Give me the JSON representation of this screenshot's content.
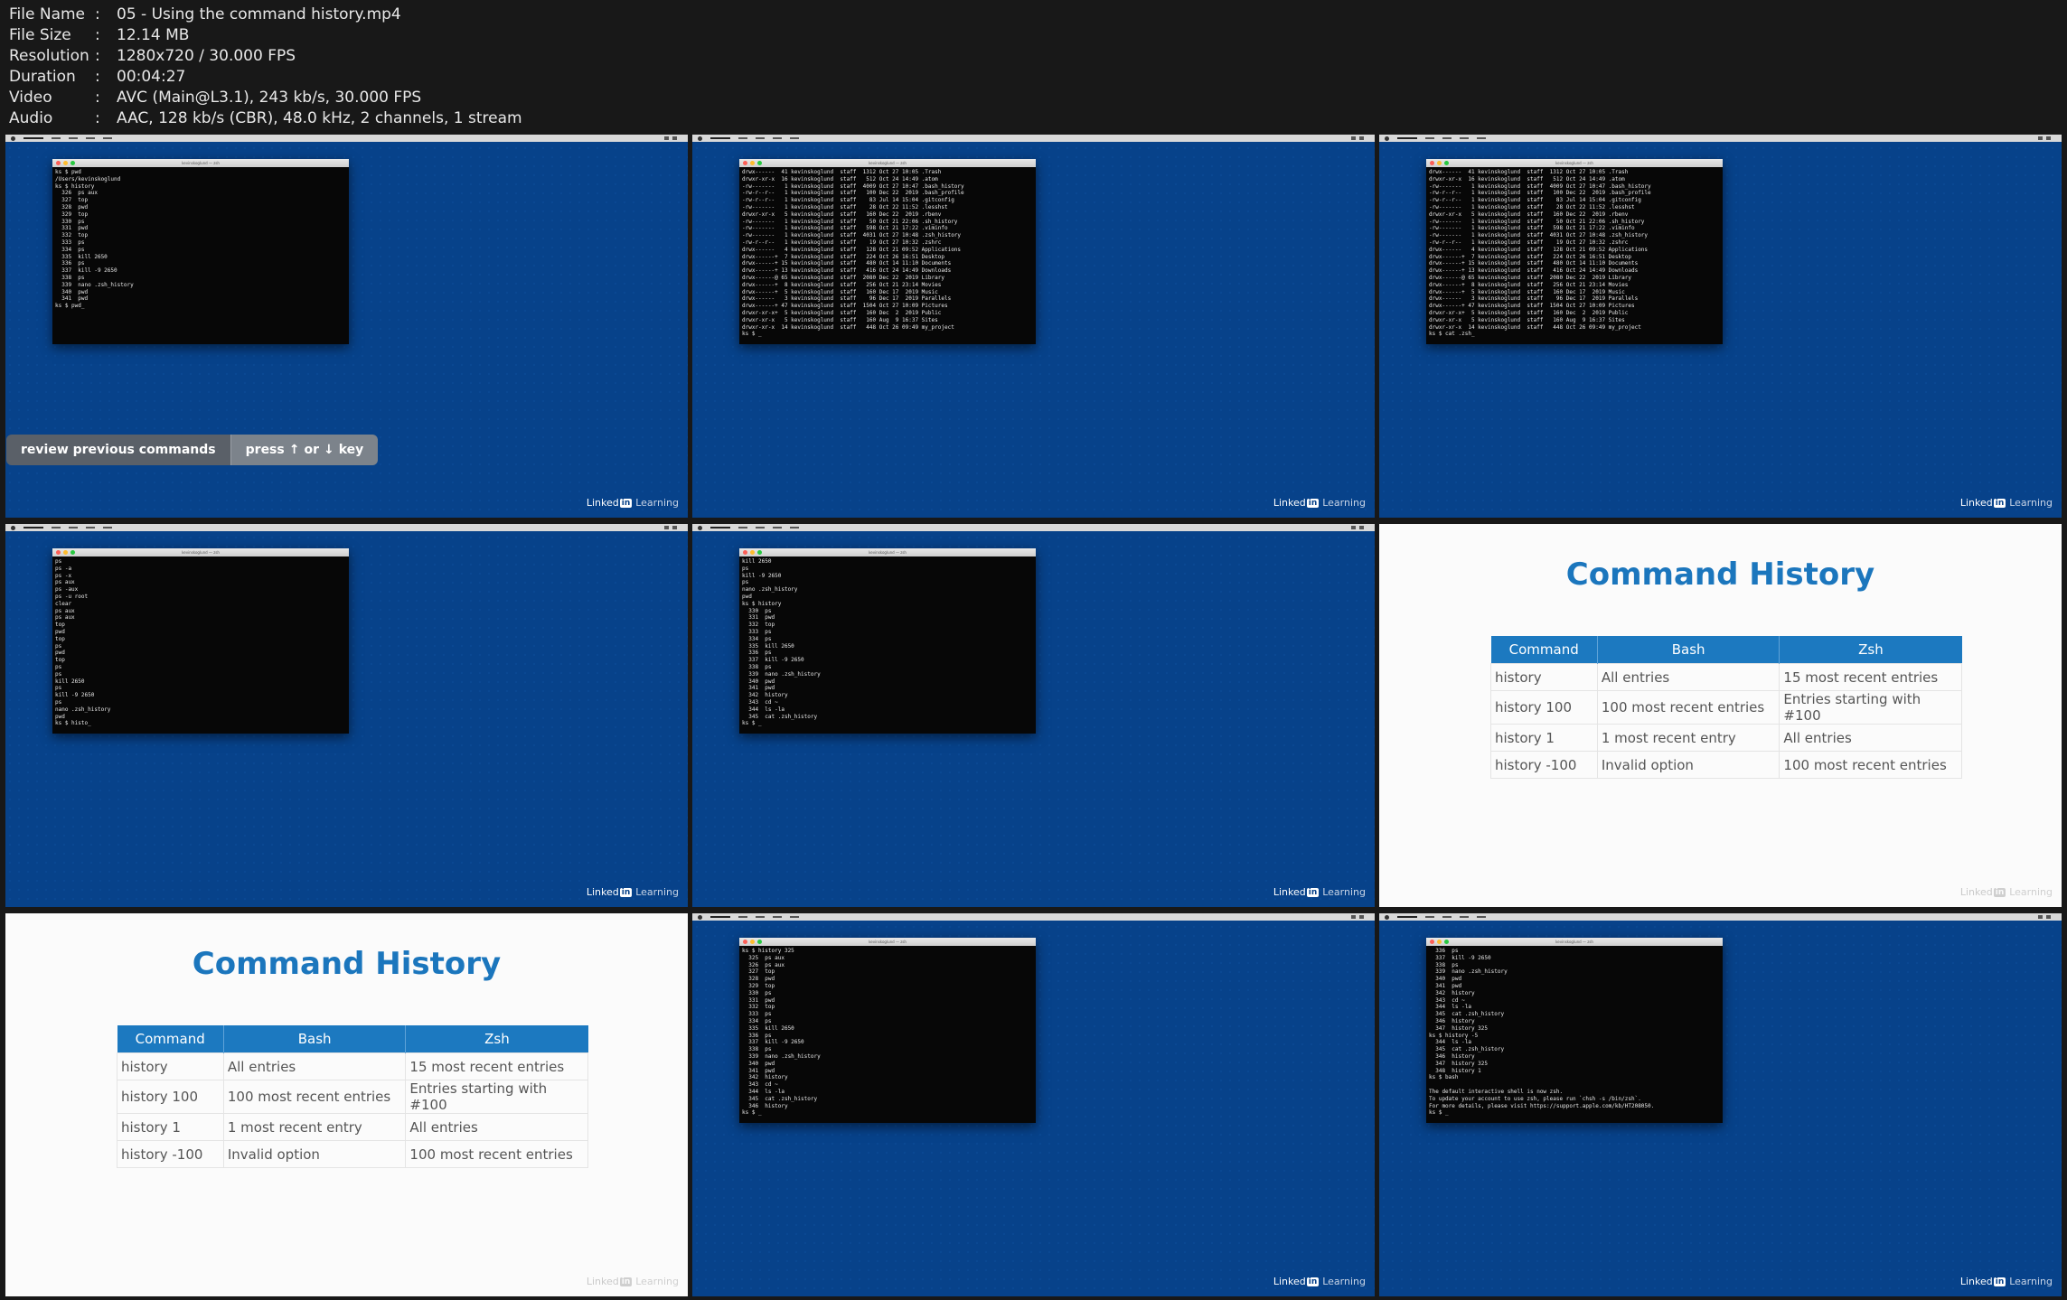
{
  "info": [
    {
      "key": "File Name",
      "value": "05 - Using the command history.mp4"
    },
    {
      "key": "File Size",
      "value": "12.14 MB"
    },
    {
      "key": "Resolution",
      "value": "1280x720 / 30.000 FPS"
    },
    {
      "key": "Duration",
      "value": "00:04:27"
    },
    {
      "key": "Video",
      "value": "AVC (Main@L3.1), 243 kb/s, 30.000 FPS"
    },
    {
      "key": "Audio",
      "value": "AAC, 128 kb/s (CBR), 48.0 kHz, 2 channels, 1 stream"
    }
  ],
  "colon": ":",
  "terminal_title": "kevinskoglund — zsh",
  "brand": {
    "linked": "Linked",
    "in": "in",
    "learning": "Learning"
  },
  "caption": {
    "left": "review previous commands",
    "press": "press",
    "up": "↑",
    "or": "or",
    "down": "↓",
    "key": "key"
  },
  "slide": {
    "title": "Command History",
    "headers": [
      "Command",
      "Bash",
      "Zsh"
    ],
    "rows": [
      [
        "history",
        "All entries",
        "15 most recent entries"
      ],
      [
        "history 100",
        "100 most recent entries",
        "Entries starting with #100"
      ],
      [
        "history 1",
        "1 most recent entry",
        "All entries"
      ],
      [
        "history -100",
        "Invalid option",
        "100 most recent entries"
      ]
    ]
  },
  "terminals": {
    "t1": "ks $ pwd\n/Users/kevinskoglund\nks $ history\n  326  ps aux\n  327  top\n  328  pwd\n  329  top\n  330  ps\n  331  pwd\n  332  top\n  333  ps\n  334  ps\n  335  kill 2650\n  336  ps\n  337  kill -9 2650\n  338  ps\n  339  nano .zsh_history\n  340  pwd\n  341  pwd\nks $ pwd_",
    "t2": "drwx------  41 kevinskoglund  staff  1312 Oct 27 10:05 .Trash\ndrwxr-xr-x  16 kevinskoglund  staff   512 Oct 24 14:49 .atom\n-rw-------   1 kevinskoglund  staff  4009 Oct 27 10:47 .bash_history\n-rw-r--r--   1 kevinskoglund  staff   100 Dec 22  2019 .bash_profile\n-rw-r--r--   1 kevinskoglund  staff    83 Jul 14 15:04 .gitconfig\n-rw-------   1 kevinskoglund  staff    28 Oct 22 11:52 .lesshst\ndrwxr-xr-x   5 kevinskoglund  staff   160 Dec 22  2019 .rbenv\n-rw-------   1 kevinskoglund  staff    50 Oct 21 22:06 .sh_history\n-rw-------   1 kevinskoglund  staff   598 Oct 21 17:22 .viminfo\n-rw-------   1 kevinskoglund  staff  4031 Oct 27 10:48 .zsh_history\n-rw-r--r--   1 kevinskoglund  staff    19 Oct 27 10:32 .zshrc\ndrwx------   4 kevinskoglund  staff   128 Oct 21 09:52 Applications\ndrwx------+  7 kevinskoglund  staff   224 Oct 26 16:51 Desktop\ndrwx------+ 15 kevinskoglund  staff   480 Oct 14 11:10 Documents\ndrwx------+ 13 kevinskoglund  staff   416 Oct 24 14:49 Downloads\ndrwx------@ 65 kevinskoglund  staff  2080 Dec 22  2019 Library\ndrwx------+  8 kevinskoglund  staff   256 Oct 21 23:14 Movies\ndrwx------+  5 kevinskoglund  staff   160 Dec 17  2019 Music\ndrwx------   3 kevinskoglund  staff    96 Dec 17  2019 Parallels\ndrwx------+ 47 kevinskoglund  staff  1504 Oct 27 10:09 Pictures\ndrwxr-xr-x+  5 kevinskoglund  staff   160 Dec  2  2019 Public\ndrwxr-xr-x   5 kevinskoglund  staff   160 Aug  9 16:37 Sites\ndrwxr-xr-x  14 kevinskoglund  staff   448 Oct 26 09:49 my_project\nks $ _",
    "t3": "drwx------  41 kevinskoglund  staff  1312 Oct 27 10:05 .Trash\ndrwxr-xr-x  16 kevinskoglund  staff   512 Oct 24 14:49 .atom\n-rw-------   1 kevinskoglund  staff  4009 Oct 27 10:47 .bash_history\n-rw-r--r--   1 kevinskoglund  staff   100 Dec 22  2019 .bash_profile\n-rw-r--r--   1 kevinskoglund  staff    83 Jul 14 15:04 .gitconfig\n-rw-------   1 kevinskoglund  staff    28 Oct 22 11:52 .lesshst\ndrwxr-xr-x   5 kevinskoglund  staff   160 Dec 22  2019 .rbenv\n-rw-------   1 kevinskoglund  staff    50 Oct 21 22:06 .sh_history\n-rw-------   1 kevinskoglund  staff   598 Oct 21 17:22 .viminfo\n-rw-------   1 kevinskoglund  staff  4031 Oct 27 10:48 .zsh_history\n-rw-r--r--   1 kevinskoglund  staff    19 Oct 27 10:32 .zshrc\ndrwx------   4 kevinskoglund  staff   128 Oct 21 09:52 Applications\ndrwx------+  7 kevinskoglund  staff   224 Oct 26 16:51 Desktop\ndrwx------+ 15 kevinskoglund  staff   480 Oct 14 11:10 Documents\ndrwx------+ 13 kevinskoglund  staff   416 Oct 24 14:49 Downloads\ndrwx------@ 65 kevinskoglund  staff  2080 Dec 22  2019 Library\ndrwx------+  8 kevinskoglund  staff   256 Oct 21 23:14 Movies\ndrwx------+  5 kevinskoglund  staff   160 Dec 17  2019 Music\ndrwx------   3 kevinskoglund  staff    96 Dec 17  2019 Parallels\ndrwx------+ 47 kevinskoglund  staff  1504 Oct 27 10:09 Pictures\ndrwxr-xr-x+  5 kevinskoglund  staff   160 Dec  2  2019 Public\ndrwxr-xr-x   5 kevinskoglund  staff   160 Aug  9 16:37 Sites\ndrwxr-xr-x  14 kevinskoglund  staff   448 Oct 26 09:49 my_project\nks $ cat .zsh_",
    "t4": "ps\nps -a\nps -x\nps aux\nps -aux\nps -u root\nclear\nps aux\nps aux\ntop\npwd\ntop\nps\npwd\ntop\nps\nps\nkill 2650\nps\nkill -9 2650\nps\nnano .zsh_history\npwd\nks $ histo_",
    "t5": "kill 2650\nps\nkill -9 2650\nps\nnano .zsh_history\npwd\nks $ history\n  330  ps\n  331  pwd\n  332  top\n  333  ps\n  334  ps\n  335  kill 2650\n  336  ps\n  337  kill -9 2650\n  338  ps\n  339  nano .zsh_history\n  340  pwd\n  341  pwd\n  342  history\n  343  cd ~\n  344  ls -la\n  345  cat .zsh_history\nks $ _",
    "t8": "ks $ history 325\n  325  ps aux\n  326  ps aux\n  327  top\n  328  pwd\n  329  top\n  330  ps\n  331  pwd\n  332  top\n  333  ps\n  334  ps\n  335  kill 2650\n  336  ps\n  337  kill -9 2650\n  338  ps\n  339  nano .zsh_history\n  340  pwd\n  341  pwd\n  342  history\n  343  cd ~\n  344  ls -la\n  345  cat .zsh_history\n  346  history\nks $ _",
    "t9": "  336  ps\n  337  kill -9 2650\n  338  ps\n  339  nano .zsh_history\n  340  pwd\n  341  pwd\n  342  history\n  343  cd ~\n  344  ls -la\n  345  cat .zsh_history\n  346  history\n  347  history 325\nks $ history -5\n  344  ls -la\n  345  cat .zsh_history\n  346  history\n  347  history 325\n  348  history 1\nks $ bash\n\nThe default interactive shell is now zsh.\nTo update your account to use zsh, please run `chsh -s /bin/zsh`.\nFor more details, please visit https://support.apple.com/kb/HT208050.\nks $ _"
  }
}
